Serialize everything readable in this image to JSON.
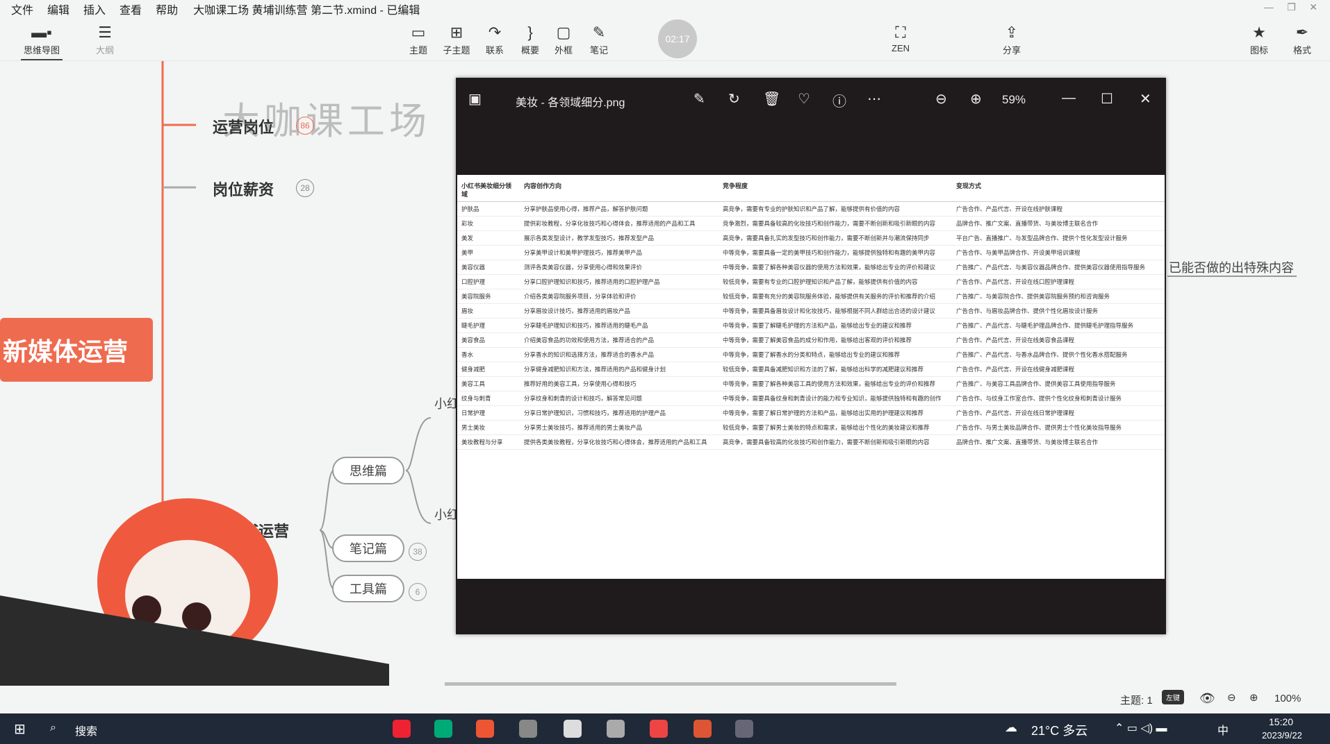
{
  "menubar": {
    "items": [
      "文件",
      "编辑",
      "插入",
      "查看",
      "帮助"
    ],
    "window_title": "大咖课工场 黄埔训练营 第二节.xmind - 已编辑"
  },
  "toolbar": {
    "mindmap": "思维导图",
    "outline": "大纲",
    "topic": "主题",
    "subtopic": "子主题",
    "relation": "联系",
    "summary": "概要",
    "boundary": "外框",
    "note": "笔记",
    "zen": "ZEN",
    "share": "分享",
    "icon": "图标",
    "format": "格式",
    "timer": "02:17"
  },
  "canvas": {
    "watermark": "大咖课工场",
    "root": "新媒体运营",
    "topics": [
      {
        "label": "运营岗位",
        "count": "86"
      },
      {
        "label": "岗位薪资",
        "count": "28"
      }
    ],
    "partial_topic": "书运营",
    "side_text": "已能否做的出特殊内容",
    "sub_prefix_1": "小红",
    "sub_prefix_2": "小红",
    "branches": [
      {
        "label": "思维篇",
        "count": ""
      },
      {
        "label": "笔记篇",
        "count": "38"
      },
      {
        "label": "工具篇",
        "count": "6"
      }
    ]
  },
  "viewer": {
    "filename": "美妆 - 各领域细分.png",
    "zoom": "59%",
    "table": {
      "headers": [
        "小红书美妆细分领域",
        "内容创作方向",
        "竞争程度",
        "变现方式"
      ],
      "rows": [
        [
          "护肤品",
          "分享护肤品使用心得，推荐产品，解答护肤问题",
          "高竞争，需要有专业的护肤知识和产品了解，能够提供有价值的内容",
          "广告合作、产品代言、开设在线护肤课程"
        ],
        [
          "彩妆",
          "提供彩妆教程，分享化妆技巧和心得体会，推荐适用的产品和工具",
          "竞争激烈，需要具备较高的化妆技巧和创作能力，需要不断创新和吸引新眼的内容",
          "品牌合作、推广文案、直播带货、与美妆博主联名合作"
        ],
        [
          "美发",
          "展示各类发型设计，教学发型技巧，推荐发型产品",
          "高竞争，需要具备扎实的发型技巧和创作能力，需要不断创新并与潮流保持同步",
          "平台广告、直播推广、与发型品牌合作、提供个性化发型设计服务"
        ],
        [
          "美甲",
          "分享美甲设计和美甲护理技巧，推荐美甲产品",
          "中等竞争，需要具备一定的美甲技巧和创作能力，能够提供独特和有趣的美甲内容",
          "广告合作、与美甲品牌合作、开设美甲培训课程"
        ],
        [
          "美容仪器",
          "测评各类美容仪器，分享使用心得和效果评价",
          "中等竞争，需要了解各种美容仪器的使用方法和效果，能够给出专业的评价和建议",
          "广告推广、产品代言、与美容仪器品牌合作、提供美容仪器使用指导服务"
        ],
        [
          "口腔护理",
          "分享口腔护理知识和技巧，推荐适用的口腔护理产品",
          "较低竞争，需要有专业的口腔护理知识和产品了解，能够提供有价值的内容",
          "广告合作、产品代言、开设在线口腔护理课程"
        ],
        [
          "美容院服务",
          "介绍各类美容院服务项目，分享体验和评价",
          "较低竞争，需要有充分的美容院服务体验，能够提供有关服务的评价和推荐的介绍",
          "广告推广、与美容院合作、提供美容院服务预约和咨询服务"
        ],
        [
          "眉妆",
          "分享眉妆设计技巧，推荐适用的眉妆产品",
          "中等竞争，需要具备眉妆设计和化妆技巧，能够根据不同人群给出合适的设计建议",
          "广告合作、与眉妆品牌合作、提供个性化眉妆设计服务"
        ],
        [
          "睫毛护理",
          "分享睫毛护理知识和技巧，推荐适用的睫毛产品",
          "中等竞争，需要了解睫毛护理的方法和产品，能够给出专业的建议和推荐",
          "广告推广、产品代言、与睫毛护理品牌合作、提供睫毛护理指导服务"
        ],
        [
          "美容食品",
          "介绍美容食品的功效和使用方法，推荐适合的产品",
          "中等竞争，需要了解美容食品的成分和作用，能够给出客观的评价和推荐",
          "广告合作、产品代言、开设在线美容食品课程"
        ],
        [
          "香水",
          "分享香水的知识和选择方法，推荐适合的香水产品",
          "中等竞争，需要了解香水的分类和特点，能够给出专业的建议和推荐",
          "广告推广、产品代言、与香水品牌合作、提供个性化香水搭配服务"
        ],
        [
          "健身减肥",
          "分享健身减肥知识和方法，推荐适用的产品和健身计划",
          "较低竞争，需要具备减肥知识和方法的了解，能够给出科学的减肥建议和推荐",
          "广告合作、产品代言、开设在线健身减肥课程"
        ],
        [
          "美容工具",
          "推荐好用的美容工具，分享使用心得和技巧",
          "中等竞争，需要了解各种美容工具的使用方法和效果，能够给出专业的评价和推荐",
          "广告推广、与美容工具品牌合作、提供美容工具使用指导服务"
        ],
        [
          "纹身与刺青",
          "分享纹身和刺青的设计和技巧，解答常见问题",
          "中等竞争，需要具备纹身和刺青设计的能力和专业知识，能够提供独特和有趣的创作",
          "广告合作、与纹身工作室合作、提供个性化纹身和刺青设计服务"
        ],
        [
          "日常护理",
          "分享日常护理知识，习惯和技巧，推荐适用的护理产品",
          "中等竞争，需要了解日常护理的方法和产品，能够给出实用的护理建议和推荐",
          "广告合作、产品代言、开设在线日常护理课程"
        ],
        [
          "男士美妆",
          "分享男士美妆技巧，推荐适用的男士美妆产品",
          "较低竞争，需要了解男士美妆的特点和需求，能够给出个性化的美妆建议和推荐",
          "广告合作、与男士美妆品牌合作、提供男士个性化美妆指导服务"
        ],
        [
          "美妆教程与分享",
          "提供各类美妆教程，分享化妆技巧和心得体会，推荐适用的产品和工具",
          "高竞争，需要具备较高的化妆技巧和创作能力，需要不断创新和吸引新眼的内容",
          "品牌合作、推广文案、直播带货、与美妆博主联名合作"
        ]
      ]
    }
  },
  "statusbar": {
    "topic_count": "主题: 1",
    "zoom": "100%",
    "tag": "左键"
  },
  "taskbar": {
    "search": "搜索",
    "weather": "21°C 多云",
    "ime": "中",
    "time": "15:20",
    "date": "2023/9/22"
  },
  "colors": {
    "accent": "#ef6b4f",
    "viewer_bg": "#1f1a1b",
    "taskbar_bg": "#1f2937"
  }
}
